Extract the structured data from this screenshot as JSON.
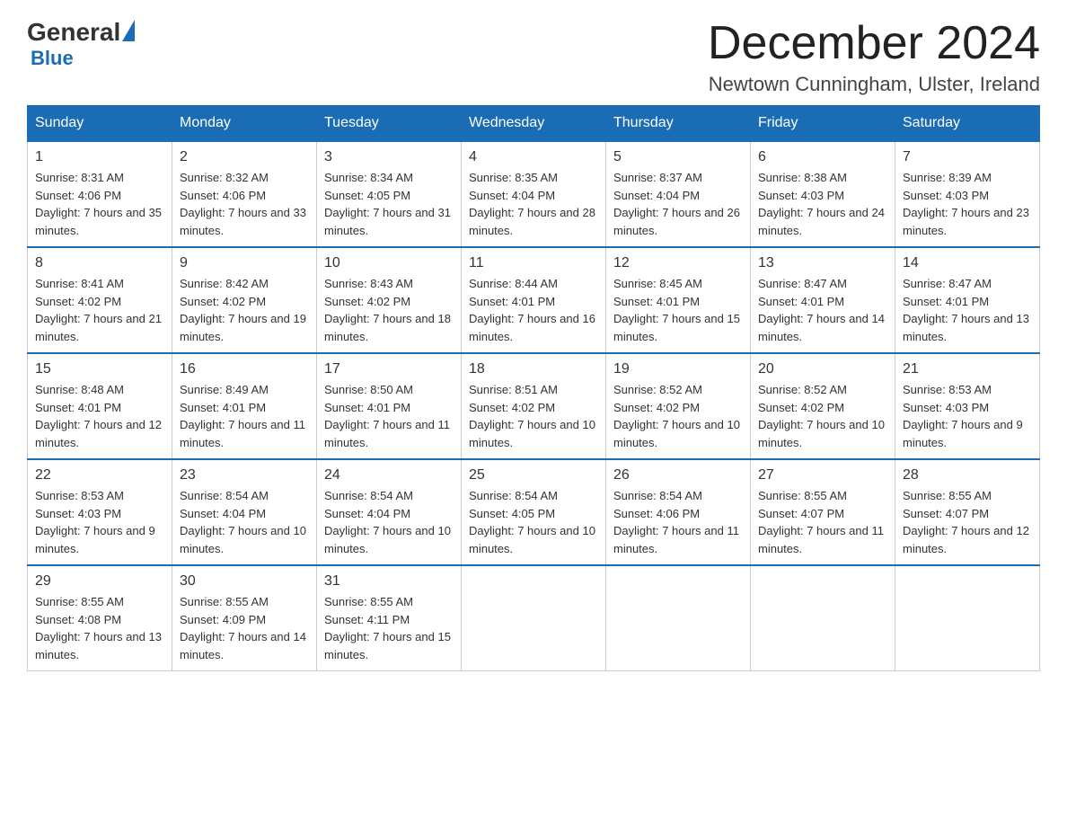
{
  "header": {
    "logo_general": "General",
    "logo_blue": "Blue",
    "month_title": "December 2024",
    "location": "Newtown Cunningham, Ulster, Ireland"
  },
  "days_of_week": [
    "Sunday",
    "Monday",
    "Tuesday",
    "Wednesday",
    "Thursday",
    "Friday",
    "Saturday"
  ],
  "weeks": [
    [
      {
        "day": "1",
        "sunrise": "8:31 AM",
        "sunset": "4:06 PM",
        "daylight": "7 hours and 35 minutes."
      },
      {
        "day": "2",
        "sunrise": "8:32 AM",
        "sunset": "4:06 PM",
        "daylight": "7 hours and 33 minutes."
      },
      {
        "day": "3",
        "sunrise": "8:34 AM",
        "sunset": "4:05 PM",
        "daylight": "7 hours and 31 minutes."
      },
      {
        "day": "4",
        "sunrise": "8:35 AM",
        "sunset": "4:04 PM",
        "daylight": "7 hours and 28 minutes."
      },
      {
        "day": "5",
        "sunrise": "8:37 AM",
        "sunset": "4:04 PM",
        "daylight": "7 hours and 26 minutes."
      },
      {
        "day": "6",
        "sunrise": "8:38 AM",
        "sunset": "4:03 PM",
        "daylight": "7 hours and 24 minutes."
      },
      {
        "day": "7",
        "sunrise": "8:39 AM",
        "sunset": "4:03 PM",
        "daylight": "7 hours and 23 minutes."
      }
    ],
    [
      {
        "day": "8",
        "sunrise": "8:41 AM",
        "sunset": "4:02 PM",
        "daylight": "7 hours and 21 minutes."
      },
      {
        "day": "9",
        "sunrise": "8:42 AM",
        "sunset": "4:02 PM",
        "daylight": "7 hours and 19 minutes."
      },
      {
        "day": "10",
        "sunrise": "8:43 AM",
        "sunset": "4:02 PM",
        "daylight": "7 hours and 18 minutes."
      },
      {
        "day": "11",
        "sunrise": "8:44 AM",
        "sunset": "4:01 PM",
        "daylight": "7 hours and 16 minutes."
      },
      {
        "day": "12",
        "sunrise": "8:45 AM",
        "sunset": "4:01 PM",
        "daylight": "7 hours and 15 minutes."
      },
      {
        "day": "13",
        "sunrise": "8:47 AM",
        "sunset": "4:01 PM",
        "daylight": "7 hours and 14 minutes."
      },
      {
        "day": "14",
        "sunrise": "8:47 AM",
        "sunset": "4:01 PM",
        "daylight": "7 hours and 13 minutes."
      }
    ],
    [
      {
        "day": "15",
        "sunrise": "8:48 AM",
        "sunset": "4:01 PM",
        "daylight": "7 hours and 12 minutes."
      },
      {
        "day": "16",
        "sunrise": "8:49 AM",
        "sunset": "4:01 PM",
        "daylight": "7 hours and 11 minutes."
      },
      {
        "day": "17",
        "sunrise": "8:50 AM",
        "sunset": "4:01 PM",
        "daylight": "7 hours and 11 minutes."
      },
      {
        "day": "18",
        "sunrise": "8:51 AM",
        "sunset": "4:02 PM",
        "daylight": "7 hours and 10 minutes."
      },
      {
        "day": "19",
        "sunrise": "8:52 AM",
        "sunset": "4:02 PM",
        "daylight": "7 hours and 10 minutes."
      },
      {
        "day": "20",
        "sunrise": "8:52 AM",
        "sunset": "4:02 PM",
        "daylight": "7 hours and 10 minutes."
      },
      {
        "day": "21",
        "sunrise": "8:53 AM",
        "sunset": "4:03 PM",
        "daylight": "7 hours and 9 minutes."
      }
    ],
    [
      {
        "day": "22",
        "sunrise": "8:53 AM",
        "sunset": "4:03 PM",
        "daylight": "7 hours and 9 minutes."
      },
      {
        "day": "23",
        "sunrise": "8:54 AM",
        "sunset": "4:04 PM",
        "daylight": "7 hours and 10 minutes."
      },
      {
        "day": "24",
        "sunrise": "8:54 AM",
        "sunset": "4:04 PM",
        "daylight": "7 hours and 10 minutes."
      },
      {
        "day": "25",
        "sunrise": "8:54 AM",
        "sunset": "4:05 PM",
        "daylight": "7 hours and 10 minutes."
      },
      {
        "day": "26",
        "sunrise": "8:54 AM",
        "sunset": "4:06 PM",
        "daylight": "7 hours and 11 minutes."
      },
      {
        "day": "27",
        "sunrise": "8:55 AM",
        "sunset": "4:07 PM",
        "daylight": "7 hours and 11 minutes."
      },
      {
        "day": "28",
        "sunrise": "8:55 AM",
        "sunset": "4:07 PM",
        "daylight": "7 hours and 12 minutes."
      }
    ],
    [
      {
        "day": "29",
        "sunrise": "8:55 AM",
        "sunset": "4:08 PM",
        "daylight": "7 hours and 13 minutes."
      },
      {
        "day": "30",
        "sunrise": "8:55 AM",
        "sunset": "4:09 PM",
        "daylight": "7 hours and 14 minutes."
      },
      {
        "day": "31",
        "sunrise": "8:55 AM",
        "sunset": "4:11 PM",
        "daylight": "7 hours and 15 minutes."
      },
      null,
      null,
      null,
      null
    ]
  ]
}
